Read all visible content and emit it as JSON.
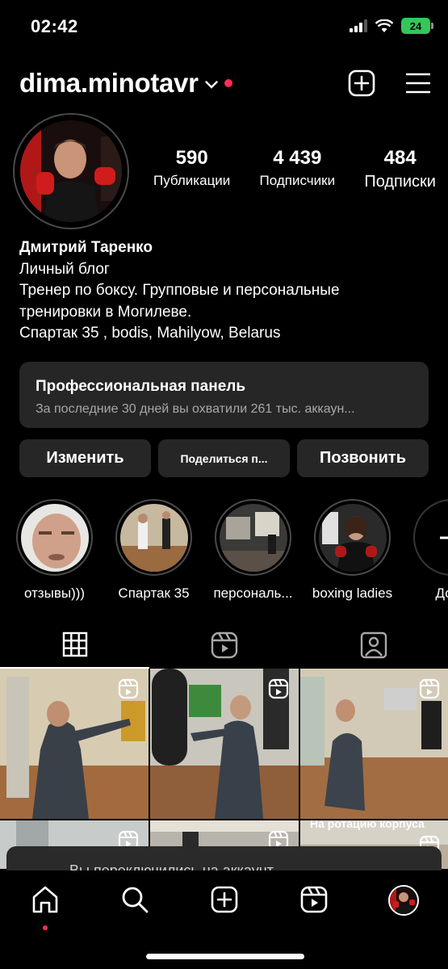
{
  "status_bar": {
    "time": "02:42",
    "battery": "24"
  },
  "header": {
    "username": "dima.minotavr"
  },
  "profile": {
    "stats": [
      {
        "value": "590",
        "label": "Публикации"
      },
      {
        "value": "4 439",
        "label": "Подписчики"
      },
      {
        "value": "484",
        "label": "Подписки"
      }
    ],
    "name": "Дмитрий Таренко",
    "bio_lines": [
      "Личный блог",
      "Тренер по боксу. Групповые и персональные",
      "тренировки в Могилеве.",
      "Спартак 35 , bodis, Mahilyow, Belarus"
    ]
  },
  "pro_panel": {
    "title": "Профессиональная панель",
    "subtitle": "За последние 30 дней вы охватили 261 тыс. аккаун..."
  },
  "buttons": {
    "edit": "Изменить",
    "share": "Поделиться п...",
    "call": "Позвонить"
  },
  "highlights": [
    {
      "label": "отзывы)))"
    },
    {
      "label": "Спартак 35"
    },
    {
      "label": "персональ..."
    },
    {
      "label": "boxing ladies"
    },
    {
      "label": "Доба"
    }
  ],
  "grid": {
    "caption_3": "На ротацию корпуса"
  },
  "toast": {
    "text": "Вы переключились на аккаунт"
  },
  "colors": {
    "accent_red": "#ff2d55",
    "panel": "#262626",
    "battery": "#34c759"
  }
}
